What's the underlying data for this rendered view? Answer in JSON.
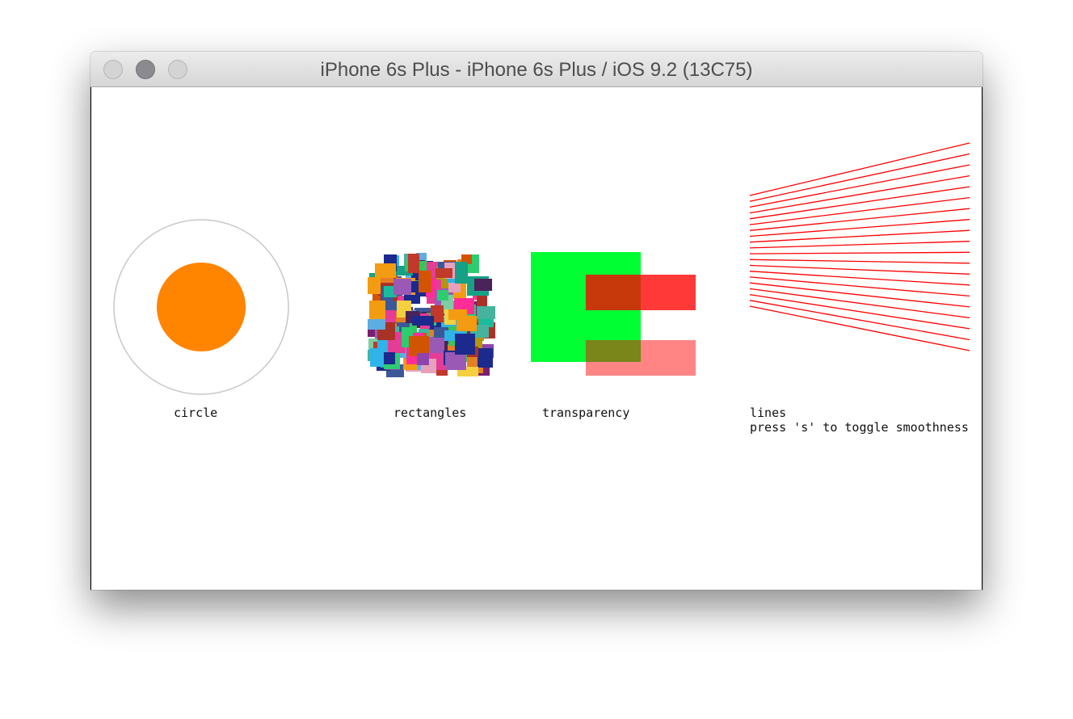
{
  "window": {
    "title": "iPhone 6s Plus - iPhone 6s Plus / iOS 9.2 (13C75)"
  },
  "canvas": {
    "labels": {
      "circle": "circle",
      "rectangles": "rectangles",
      "transparency": "transparency",
      "lines": "lines",
      "lines_hint": "press 's' to toggle smoothness"
    },
    "colors": {
      "circle_fill": "#ff8400",
      "circle_ring": "#c8c8c8",
      "transparency_green": "#00ff33",
      "transparency_red": "#ff0000",
      "lines": "#ff0000"
    }
  }
}
